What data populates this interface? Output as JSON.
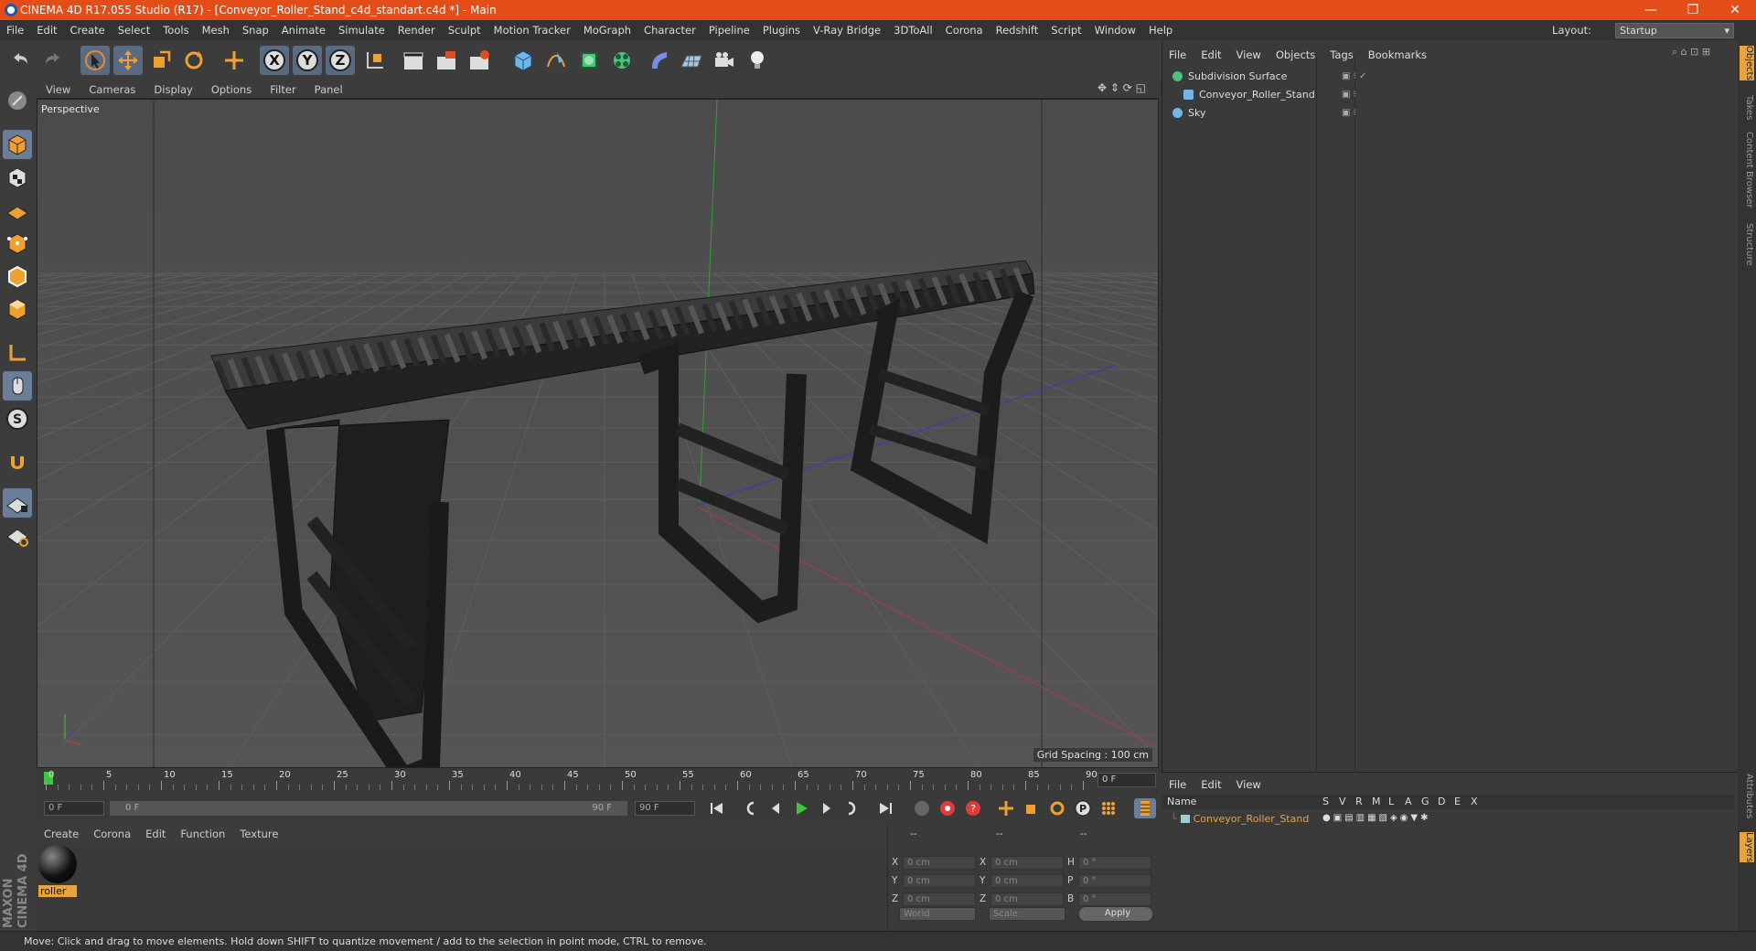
{
  "window": {
    "title": "CINEMA 4D R17.055 Studio (R17) - [Conveyor_Roller_Stand_c4d_standart.c4d *] - Main",
    "minimize": "—",
    "restore": "❐",
    "close": "✕"
  },
  "menubar": [
    "File",
    "Edit",
    "Create",
    "Select",
    "Tools",
    "Mesh",
    "Snap",
    "Animate",
    "Simulate",
    "Render",
    "Sculpt",
    "Motion Tracker",
    "MoGraph",
    "Character",
    "Pipeline",
    "Plugins",
    "V-Ray Bridge",
    "3DToAll",
    "Corona",
    "Redshift",
    "Script",
    "Window",
    "Help"
  ],
  "layout": {
    "label": "Layout:",
    "value": "Startup"
  },
  "toolbar": {
    "axis_x": "X",
    "axis_y": "Y",
    "axis_z": "Z"
  },
  "viewport": {
    "menu": [
      "View",
      "Cameras",
      "Display",
      "Options",
      "Filter",
      "Panel"
    ],
    "label": "Perspective",
    "grid_spacing": "Grid Spacing : 100 cm"
  },
  "timeline": {
    "ticks": [
      "0",
      "5",
      "10",
      "15",
      "20",
      "25",
      "30",
      "35",
      "40",
      "45",
      "50",
      "55",
      "60",
      "65",
      "70",
      "75",
      "80",
      "85",
      "90"
    ],
    "current_frame": "0 F",
    "start_field": "0 F",
    "range_start": "0 F",
    "range_end": "90 F",
    "end_field": "90 F"
  },
  "material_manager": {
    "menu": [
      "Create",
      "Corona",
      "Edit",
      "Function",
      "Texture"
    ],
    "materials": [
      {
        "name": "roller"
      }
    ]
  },
  "coordinates": {
    "headers": [
      "--",
      "--",
      "--"
    ],
    "rows": [
      {
        "l1": "X",
        "v1": "0 cm",
        "l2": "X",
        "v2": "0 cm",
        "l3": "H",
        "v3": "0 °"
      },
      {
        "l1": "Y",
        "v1": "0 cm",
        "l2": "Y",
        "v2": "0 cm",
        "l3": "P",
        "v3": "0 °"
      },
      {
        "l1": "Z",
        "v1": "0 cm",
        "l2": "Z",
        "v2": "0 cm",
        "l3": "B",
        "v3": "0 °"
      }
    ],
    "mode1": "World",
    "mode2": "Scale",
    "apply": "Apply"
  },
  "object_manager": {
    "menu": [
      "File",
      "Edit",
      "View",
      "Objects",
      "Tags",
      "Bookmarks"
    ],
    "objects": [
      {
        "name": "Subdivision Surface"
      },
      {
        "name": "Conveyor_Roller_Stand"
      },
      {
        "name": "Sky"
      }
    ]
  },
  "layer_manager": {
    "menu": [
      "File",
      "Edit",
      "View"
    ],
    "columns": [
      "Name",
      "S",
      "V",
      "R",
      "M",
      "L",
      "A",
      "G",
      "D",
      "E",
      "X"
    ],
    "layers": [
      {
        "name": "Conveyor_Roller_Stand"
      }
    ]
  },
  "side_tabs": [
    "Objects",
    "Takes",
    "Content Browser",
    "Structure"
  ],
  "side_tabs_bottom": [
    "Attributes",
    "Layers"
  ],
  "status": "Move: Click and drag to move elements. Hold down SHIFT to quantize movement / add to the selection in point mode, CTRL to remove.",
  "maxon_logo": "MAXON CINEMA 4D",
  "colors": {
    "accent": "#e44d17",
    "selection": "#6a7d99",
    "layer": "#e8a33c"
  }
}
